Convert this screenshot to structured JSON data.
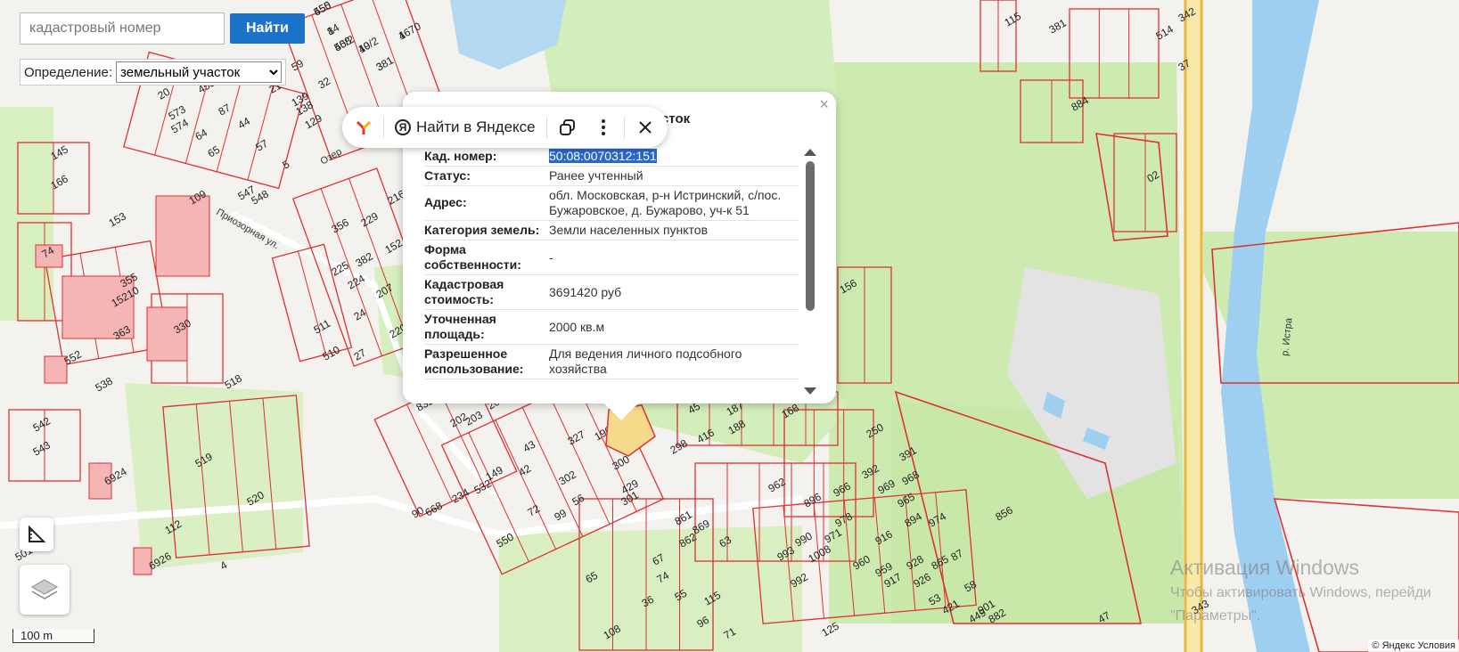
{
  "search": {
    "placeholder": "кадастровый номер",
    "button_label": "Найти"
  },
  "definition": {
    "label": "Определение:",
    "selected": "земельный участок",
    "options": [
      "земельный участок"
    ]
  },
  "popup": {
    "title": "сток",
    "close_glyph": "×",
    "rows": [
      {
        "key": "Кад. номер",
        "value": "50:08:0070312:151"
      },
      {
        "key": "Статус",
        "value": "Ранее учтенный"
      },
      {
        "key": "Адрес",
        "value": "обл. Московская, р-н Истринский, с/пос. Бужаровское, д. Бужарово, уч-к 51"
      },
      {
        "key": "Категория земель",
        "value": "Земли населенных пунктов"
      },
      {
        "key": "Форма собственности",
        "value": "-"
      },
      {
        "key": "Кадастровая стоимость",
        "value": "3691420 руб"
      },
      {
        "key": "Уточненная площадь",
        "value": "2000 кв.м"
      },
      {
        "key": "Разрешенное использование",
        "value": "Для ведения личного подсобного хозяйства"
      }
    ]
  },
  "yandex_toolbar": {
    "find_label": "Найти в Яндексе",
    "ya_letter": "Я"
  },
  "map": {
    "scale_label": "100 m",
    "river_label": "р. Истра",
    "street_label": "Приозорная ул.",
    "street_label2": "Озер",
    "parcels": [
      "555",
      "14",
      "558",
      "19",
      "1",
      "3",
      "59",
      "32",
      "21",
      "139",
      "138",
      "129",
      "20",
      "573",
      "574",
      "453",
      "87",
      "64",
      "44",
      "65",
      "57",
      "5",
      "548",
      "547",
      "145",
      "166",
      "153",
      "109",
      "74",
      "355",
      "15210",
      "363",
      "330",
      "552",
      "538",
      "518",
      "542",
      "543",
      "519",
      "520",
      "6924",
      "112",
      "4",
      "5010",
      "6926",
      "511",
      "510",
      "224",
      "207",
      "225",
      "382",
      "216",
      "229",
      "356",
      "152",
      "24",
      "27",
      "220",
      "156",
      "832",
      "202",
      "203",
      "20",
      "45",
      "187",
      "188",
      "168",
      "416",
      "298",
      "327",
      "196",
      "42",
      "43",
      "149",
      "302",
      "300",
      "429",
      "301",
      "56",
      "72",
      "99",
      "90",
      "668",
      "234",
      "532",
      "550",
      "250",
      "392",
      "391",
      "969",
      "968",
      "965",
      "966",
      "962",
      "896",
      "894",
      "974",
      "978",
      "990",
      "971",
      "993",
      "1008",
      "992",
      "960",
      "959",
      "916",
      "917",
      "928",
      "926",
      "865",
      "87",
      "58",
      "53",
      "421",
      "901",
      "449",
      "882",
      "861",
      "869",
      "862",
      "63",
      "65",
      "67",
      "74",
      "36",
      "55",
      "115",
      "96",
      "108",
      "125",
      "71",
      "101",
      "37",
      "514",
      "884",
      "02",
      "115",
      "381",
      "856",
      "47",
      "343",
      "342",
      "450",
      "8",
      "40/2",
      "40/2",
      "4670",
      "381"
    ]
  },
  "watermark": {
    "title": "Активация Windows",
    "line1": "Чтобы активировать Windows, перейди",
    "line2": "\"Параметры\"."
  },
  "copyright": "© Яндекс  Условия",
  "colors": {
    "parcel_line": "#e03030",
    "parcel_fill": "#f6b5b5",
    "park": "#cdebb0",
    "water": "#b3d8f2",
    "selected": "#f7d98b",
    "button": "#1a73c8"
  }
}
